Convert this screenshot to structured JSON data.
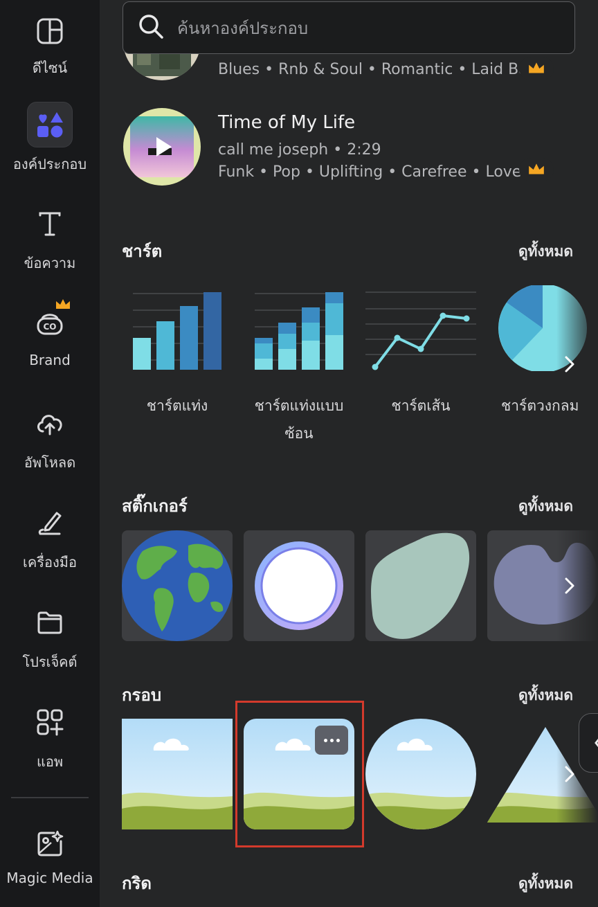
{
  "sidebar": {
    "items": [
      {
        "label": "ดีไซน์",
        "icon": "layout-icon"
      },
      {
        "label": "องค์ประกอบ",
        "icon": "elements-shapes-icon",
        "active": true
      },
      {
        "label": "ข้อความ",
        "icon": "text-icon"
      },
      {
        "label": "Brand",
        "icon": "brand-icon",
        "premium": true
      },
      {
        "label": "อัพโหลด",
        "icon": "cloud-upload-icon"
      },
      {
        "label": "เครื่องมือ",
        "icon": "draw-tool-icon"
      },
      {
        "label": "โปรเจ็คต์",
        "icon": "folder-icon"
      },
      {
        "label": "แอพ",
        "icon": "apps-grid-icon"
      },
      {
        "label": "Magic Media",
        "icon": "magic-media-icon"
      }
    ]
  },
  "search": {
    "placeholder": "ค้นหาองค์ประกอบ"
  },
  "audio": {
    "tracks": [
      {
        "tags": "Blues • Rnb & Soul • Romantic • Laid Back",
        "premium": true
      },
      {
        "title": "Time of My Life",
        "subtitle": "call me joseph • 2:29",
        "tags": "Funk • Pop • Uplifting • Carefree • Love ...",
        "premium": true
      }
    ]
  },
  "charts": {
    "title": "ชาร์ต",
    "see_all": "ดูทั้งหมด",
    "items": [
      {
        "label": "ชาร์ตแท่ง"
      },
      {
        "label": "ชาร์ตแท่งแบบ",
        "label2": "ซ้อน"
      },
      {
        "label": "ชาร์ตเส้น"
      },
      {
        "label": "ชาร์ตวงกลม"
      }
    ]
  },
  "stickers": {
    "title": "สติ๊กเกอร์",
    "see_all": "ดูทั้งหมด"
  },
  "frames": {
    "title": "กรอบ",
    "see_all": "ดูทั้งหมด"
  },
  "grids": {
    "title": "กริด",
    "see_all": "ดูทั้งหมด"
  },
  "colors": {
    "accent": "#5b5ef4",
    "highlight": "#d33a2c",
    "crown": "#f5a623"
  }
}
